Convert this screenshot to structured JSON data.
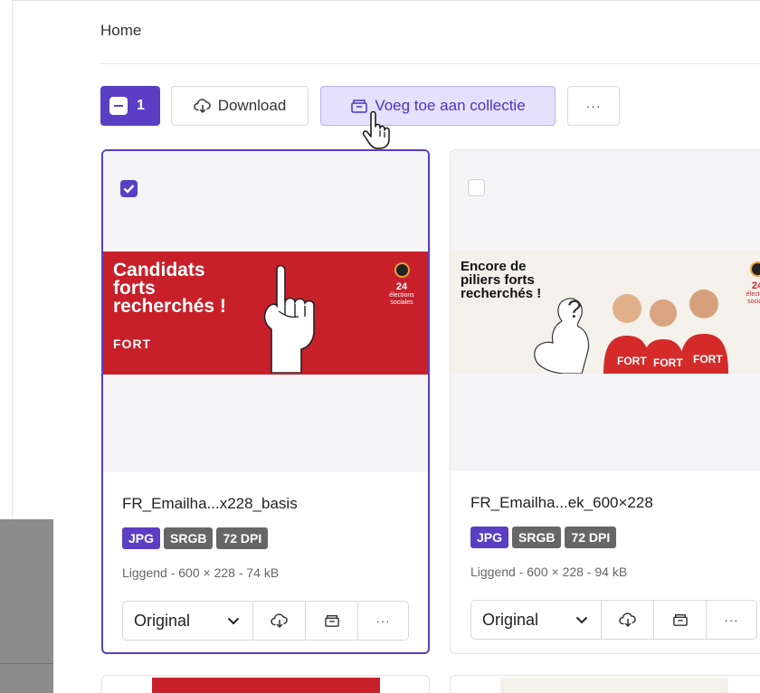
{
  "breadcrumb": {
    "home": "Home"
  },
  "toolbar": {
    "selected_count": "1",
    "download_label": "Download",
    "add_to_collection_label": "Voeg toe aan collectie",
    "more_label": "···"
  },
  "cards": [
    {
      "selected": true,
      "filename": "FR_Emailha...x228_basis",
      "tags": [
        "JPG",
        "SRGB",
        "72 DPI"
      ],
      "meta": "Liggend - 600 × 228 - 74 kB",
      "format_select": "Original",
      "more_label": "···",
      "banner": {
        "headline_lines": [
          "Candidats",
          "forts",
          "recherchés !"
        ],
        "brand": "FORT",
        "badge_number": "24",
        "badge_text": "élections sociales"
      }
    },
    {
      "selected": false,
      "filename": "FR_Emailha...ek_600×228",
      "tags": [
        "JPG",
        "SRGB",
        "72 DPI"
      ],
      "meta": "Liggend - 600 × 228 - 94 kB",
      "format_select": "Original",
      "more_label": "···",
      "banner": {
        "headline_lines": [
          "Encore de",
          "piliers forts",
          "recherchés !"
        ],
        "badge_number": "24",
        "badge_text": "élection sociale"
      }
    }
  ],
  "colors": {
    "accent": "#5a3fc4",
    "accent_light": "#e5e0fb",
    "banner_red": "#c8202a",
    "tag_gray": "#666666"
  }
}
